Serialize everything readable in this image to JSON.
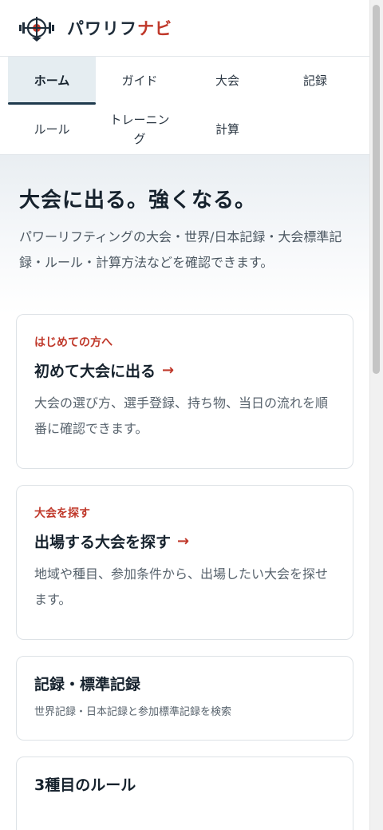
{
  "header": {
    "logo_icon": "barbell-target-icon",
    "logo_text_a": "パワリフ",
    "logo_text_b": "ナビ"
  },
  "nav": {
    "tabs": [
      {
        "label": "ホーム",
        "active": true
      },
      {
        "label": "ガイド"
      },
      {
        "label": "大会"
      },
      {
        "label": "記録"
      },
      {
        "label": "ルール"
      },
      {
        "label": "トレーニング"
      },
      {
        "label": "計算"
      }
    ]
  },
  "hero": {
    "title": "大会に出る。強くなる。",
    "text": "パワーリフティングの大会・世界/日本記録・大会標準記録・ルール・計算方法などを確認できます。"
  },
  "cards": [
    {
      "eyebrow": "はじめての方へ",
      "title": "初めて大会に出る",
      "arrow": "→",
      "desc": "大会の選び方、選手登録、持ち物、当日の流れを順番に確認できます。"
    },
    {
      "eyebrow": "大会を探す",
      "title": "出場する大会を探す",
      "arrow": "→",
      "desc": "地域や種目、参加条件から、出場したい大会を探せます。"
    },
    {
      "title": "記録・標準記録",
      "desc": "世界記録・日本記録と参加標準記録を検索"
    },
    {
      "title": "3種目のルール"
    }
  ],
  "colors": {
    "accent": "#c0392b",
    "nav_active_bg": "#e5edf1",
    "nav_active_bar": "#1f3a4d",
    "text_dark": "#16222d"
  }
}
